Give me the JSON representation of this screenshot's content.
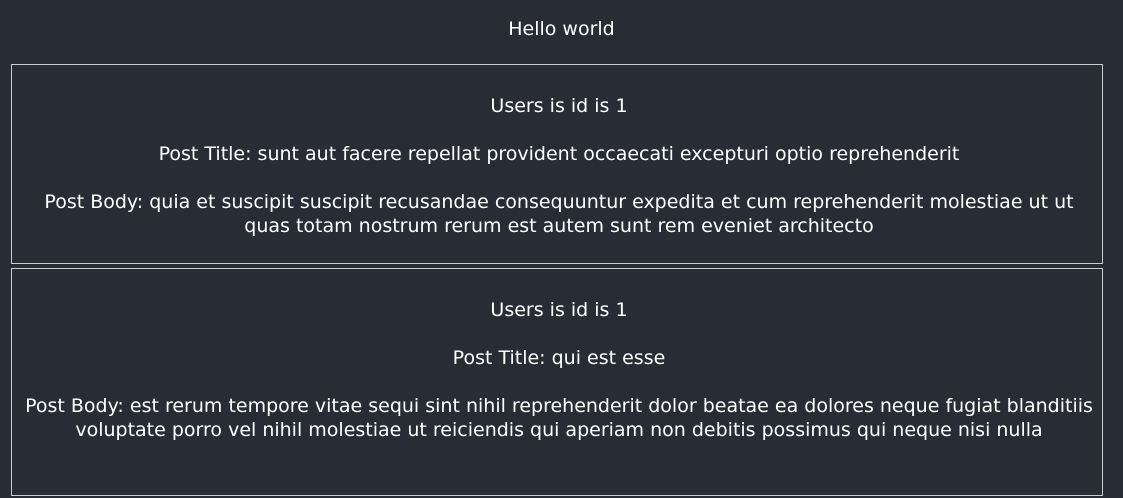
{
  "header": {
    "title": "Hello world"
  },
  "posts": [
    {
      "user_line": "Users is id is 1",
      "title_line": "Post Title: sunt aut facere repellat provident occaecati excepturi optio reprehenderit",
      "body_line": "Post Body: quia et suscipit suscipit recusandae consequuntur expedita et cum reprehenderit molestiae ut ut quas totam nostrum rerum est autem sunt rem eveniet architecto"
    },
    {
      "user_line": "Users is id is 1",
      "title_line": "Post Title: qui est esse",
      "body_line": "Post Body: est rerum tempore vitae sequi sint nihil reprehenderit dolor beatae ea dolores neque fugiat blanditiis voluptate porro vel nihil molestiae ut reiciendis qui aperiam non debitis possimus qui neque nisi nulla"
    }
  ],
  "colors": {
    "background": "#282c34",
    "text": "#ffffff",
    "border": "#c9ccd1"
  }
}
